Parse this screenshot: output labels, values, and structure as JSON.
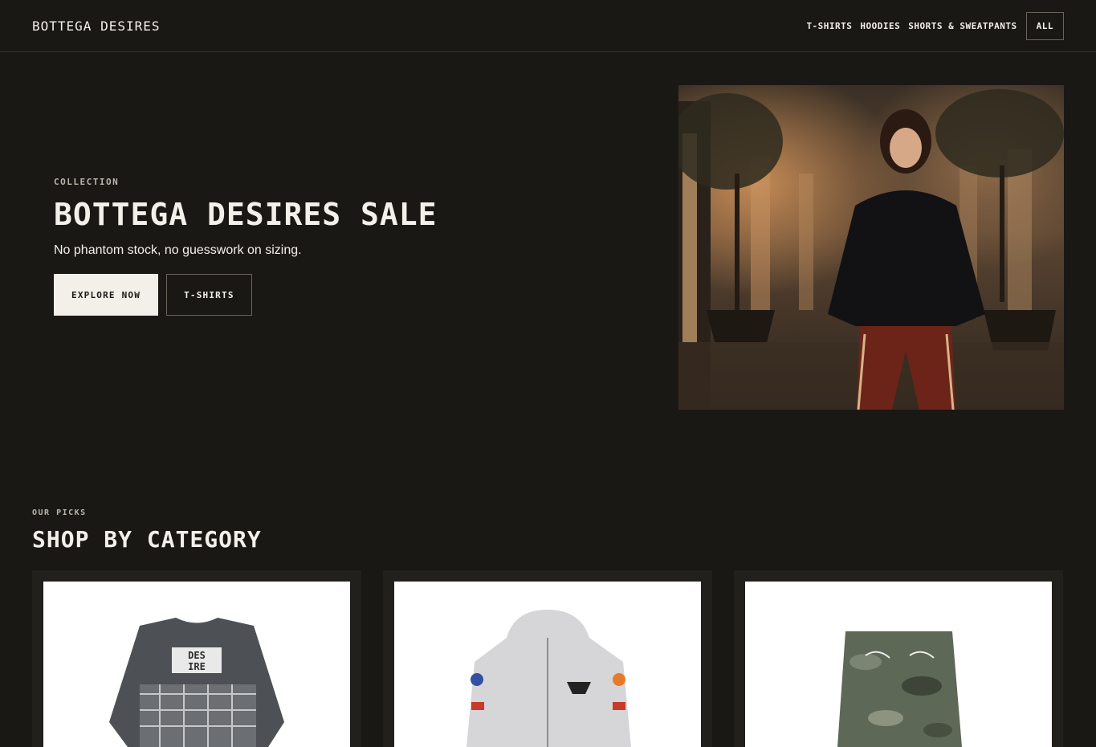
{
  "header": {
    "brand": "BOTTEGA DESIRES",
    "nav": [
      "T-SHIRTS",
      "HOODIES",
      "SHORTS & SWEATPANTS",
      "ALL"
    ]
  },
  "hero": {
    "eyebrow": "COLLECTION",
    "title": "BOTTEGA DESIRES SALE",
    "subtitle": "No phantom stock, no guesswork on sizing.",
    "primary_button": "EXPLORE NOW",
    "secondary_button": "T-SHIRTS"
  },
  "category_section": {
    "eyebrow": "OUR PICKS",
    "title": "SHOP BY CATEGORY",
    "cards": [
      {
        "image": "plaid-longsleeve-tee-icon"
      },
      {
        "image": "grey-zip-hoodie-icon"
      },
      {
        "image": "camo-shorts-icon"
      }
    ]
  },
  "colors": {
    "background": "#1a1815",
    "text": "#f3f0ea",
    "muted": "#b9b4aa"
  }
}
